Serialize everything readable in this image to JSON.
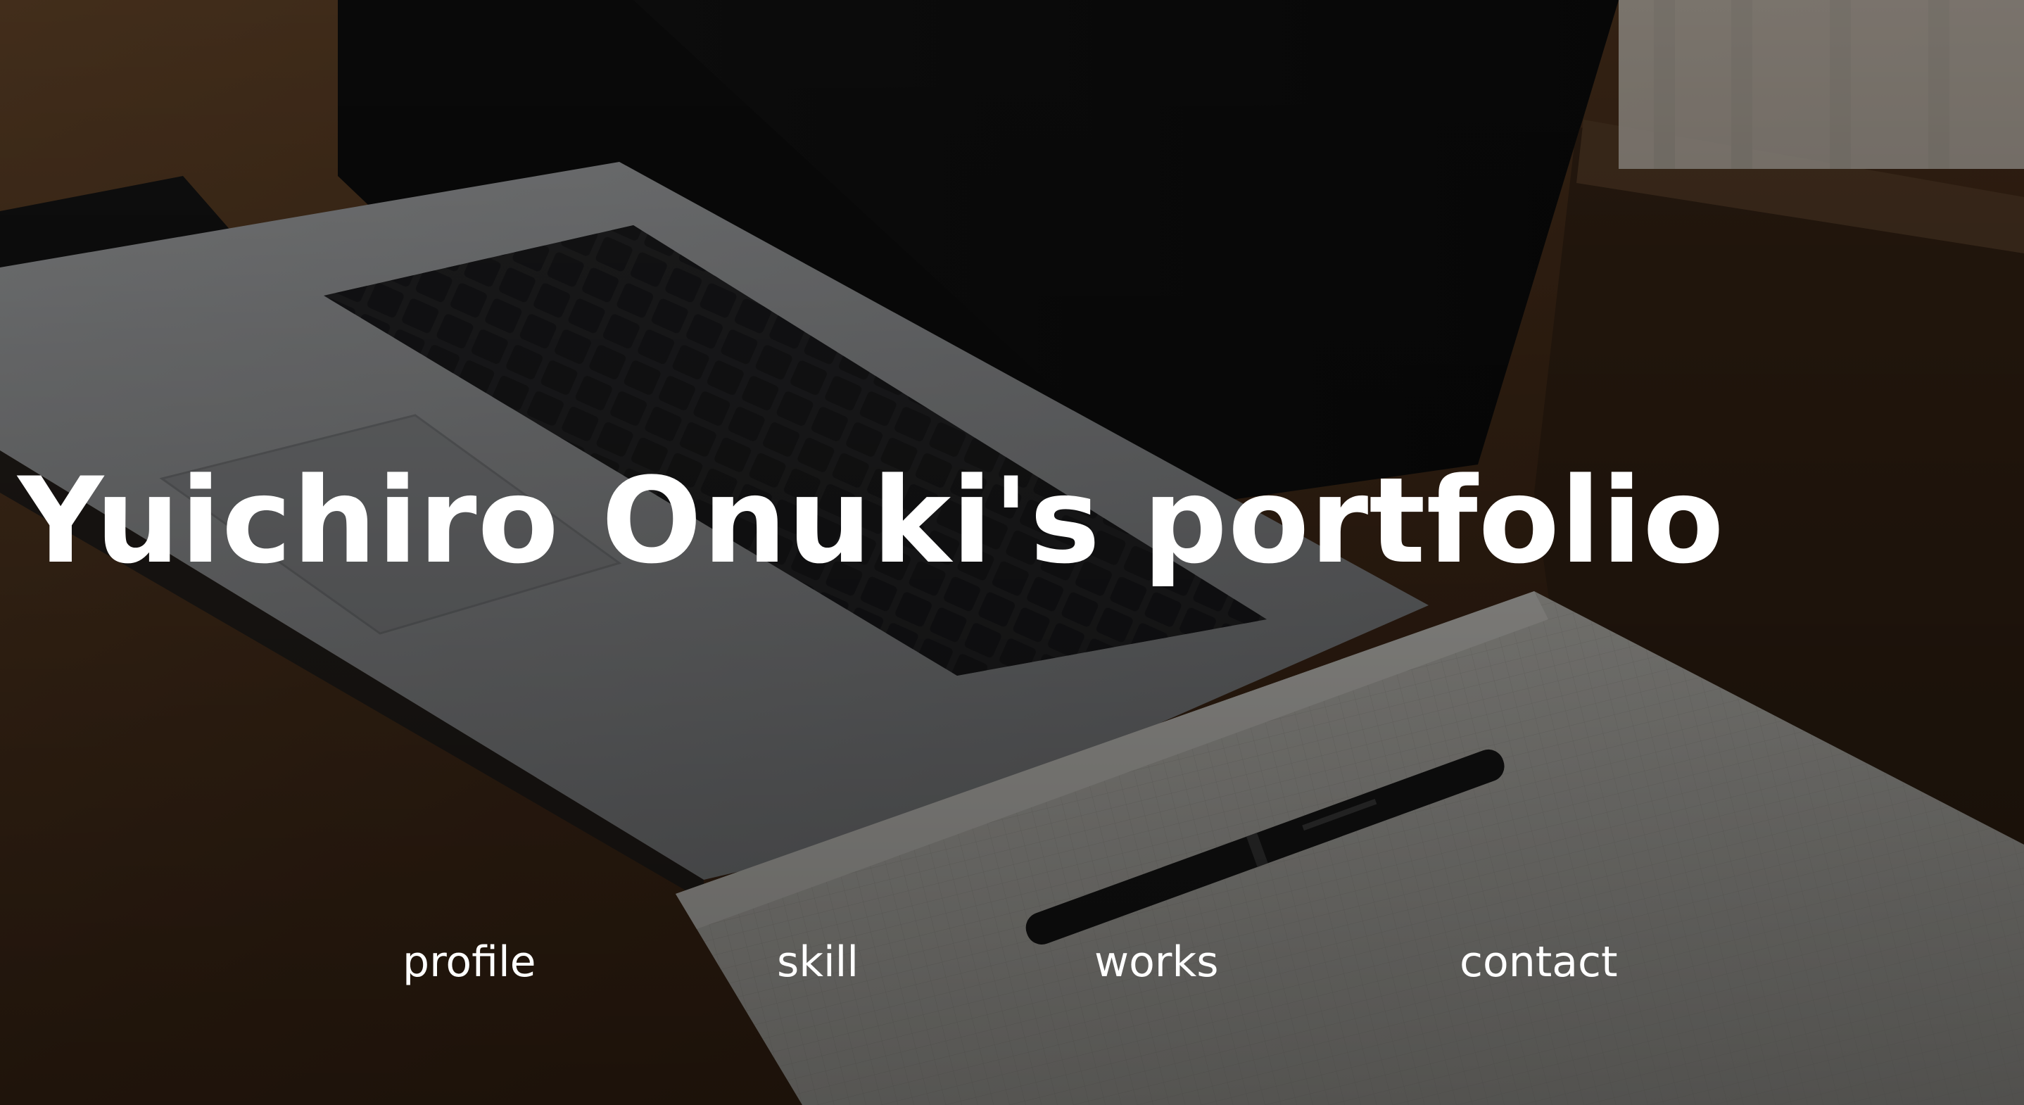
{
  "hero": {
    "title": "Yuichiro Onuki's portfolio",
    "background": "photo of laptop, notebook and pen on wooden desk"
  },
  "nav": {
    "items": [
      {
        "label": "profile"
      },
      {
        "label": "skill"
      },
      {
        "label": "works"
      },
      {
        "label": "contact"
      }
    ]
  },
  "colors": {
    "text": "#ffffff",
    "overlay": "rgba(0,0,0,0.38)",
    "desk": "#5a3a22",
    "laptop": "#a6a8ab",
    "paper": "#d8d6d0"
  }
}
